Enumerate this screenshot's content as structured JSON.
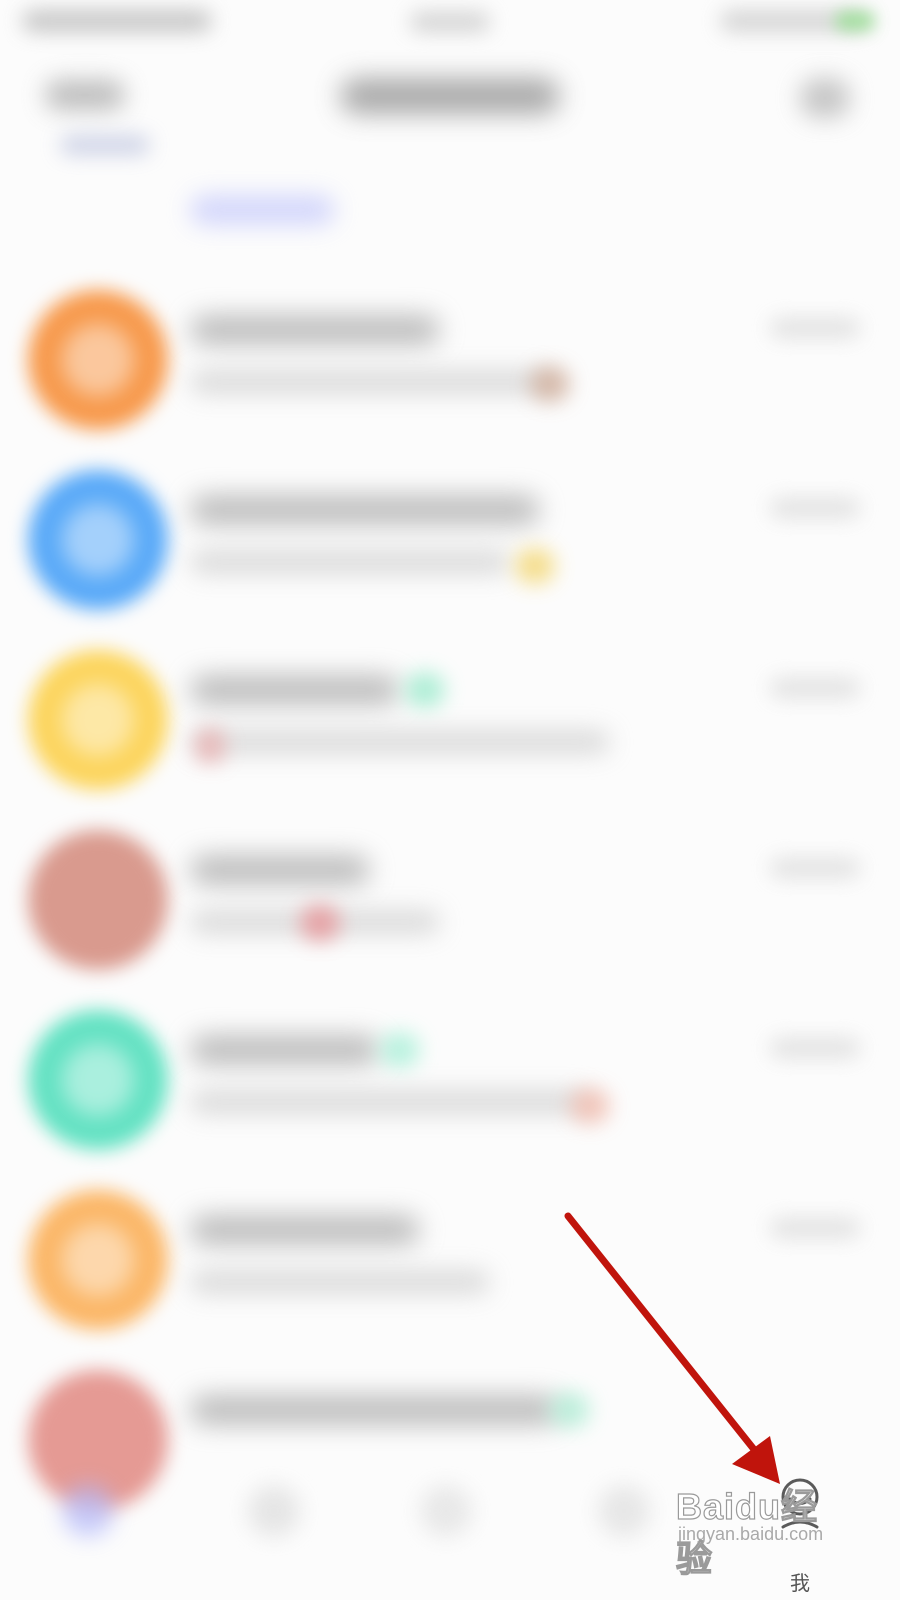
{
  "tab_bar": {
    "me_label": "我"
  },
  "watermark": {
    "brand": "Baidu经验",
    "url": "jingyan.baidu.com"
  },
  "colors": {
    "avatar_1": "#f79a4d",
    "avatar_2": "#5aaaf8",
    "avatar_3": "#fcd55e",
    "avatar_4": "#d99a8e",
    "avatar_5": "#64e2c3",
    "avatar_6": "#fbb768",
    "avatar_7": "#e59a94",
    "annotation_arrow": "#c0140c",
    "tab_active": "#b3b9fa"
  },
  "icons": {
    "me_tab": "person-icon"
  }
}
